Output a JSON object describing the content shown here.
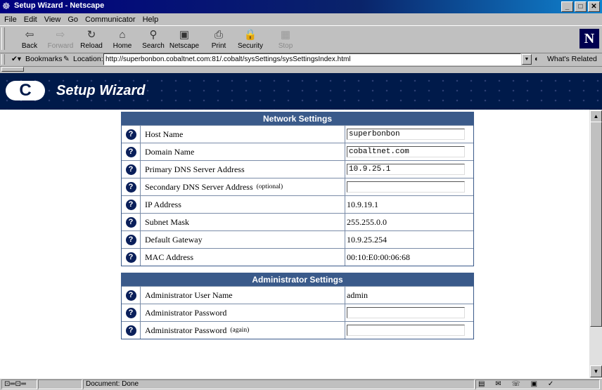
{
  "window": {
    "title": "Setup Wizard - Netscape",
    "buttons": [
      "_",
      "□",
      "✕"
    ]
  },
  "menu": [
    "File",
    "Edit",
    "View",
    "Go",
    "Communicator",
    "Help"
  ],
  "toolbar": {
    "buttons": [
      {
        "label": "Back",
        "icon": "back-arrow-icon",
        "glyph": "⇦",
        "enabled": true
      },
      {
        "label": "Forward",
        "icon": "forward-arrow-icon",
        "glyph": "⇨",
        "enabled": false
      },
      {
        "label": "Reload",
        "icon": "reload-icon",
        "glyph": "↻",
        "enabled": true
      },
      {
        "label": "Home",
        "icon": "home-icon",
        "glyph": "⌂",
        "enabled": true
      },
      {
        "label": "Search",
        "icon": "search-icon",
        "glyph": "⚲",
        "enabled": true
      },
      {
        "label": "Netscape",
        "icon": "netscape-icon",
        "glyph": "▣",
        "enabled": true
      },
      {
        "label": "Print",
        "icon": "print-icon",
        "glyph": "⎙",
        "enabled": true
      },
      {
        "label": "Security",
        "icon": "lock-icon",
        "glyph": "🔒",
        "enabled": true
      },
      {
        "label": "Stop",
        "icon": "stop-icon",
        "glyph": "▦",
        "enabled": false
      }
    ]
  },
  "location": {
    "bookmarks_label": "Bookmarks",
    "location_label": "Location:",
    "url": "http://superbonbon.cobaltnet.com:81/.cobalt/sysSettings/sysSettingsIndex.html",
    "whats_related": "What's Related"
  },
  "banner": {
    "title": "Setup Wizard",
    "logo": "C"
  },
  "network": {
    "header": "Network Settings",
    "rows": [
      {
        "label": "Host Name",
        "note": "",
        "type": "input",
        "value": "superbonbon"
      },
      {
        "label": "Domain Name",
        "note": "",
        "type": "input",
        "value": "cobaltnet.com"
      },
      {
        "label": "Primary DNS Server Address",
        "note": "",
        "type": "input",
        "value": "10.9.25.1"
      },
      {
        "label": "Secondary DNS Server Address",
        "note": "(optional)",
        "type": "input",
        "value": ""
      },
      {
        "label": "IP Address",
        "note": "",
        "type": "text",
        "value": "10.9.19.1"
      },
      {
        "label": "Subnet Mask",
        "note": "",
        "type": "text",
        "value": "255.255.0.0"
      },
      {
        "label": "Default Gateway",
        "note": "",
        "type": "text",
        "value": "10.9.25.254"
      },
      {
        "label": "MAC Address",
        "note": "",
        "type": "text",
        "value": "00:10:E0:00:06:68"
      }
    ]
  },
  "admin": {
    "header": "Administrator Settings",
    "rows": [
      {
        "label": "Administrator User Name",
        "note": "",
        "type": "text",
        "value": "admin"
      },
      {
        "label": "Administrator Password",
        "note": "",
        "type": "password",
        "value": ""
      },
      {
        "label": "Administrator Password",
        "note": "(again)",
        "type": "password",
        "value": ""
      }
    ]
  },
  "help_icon": "?",
  "status": {
    "text": "Document: Done"
  },
  "colors": {
    "banner": "#001a4a",
    "panel_header": "#3a5a8a",
    "title_bar": "#000080"
  }
}
